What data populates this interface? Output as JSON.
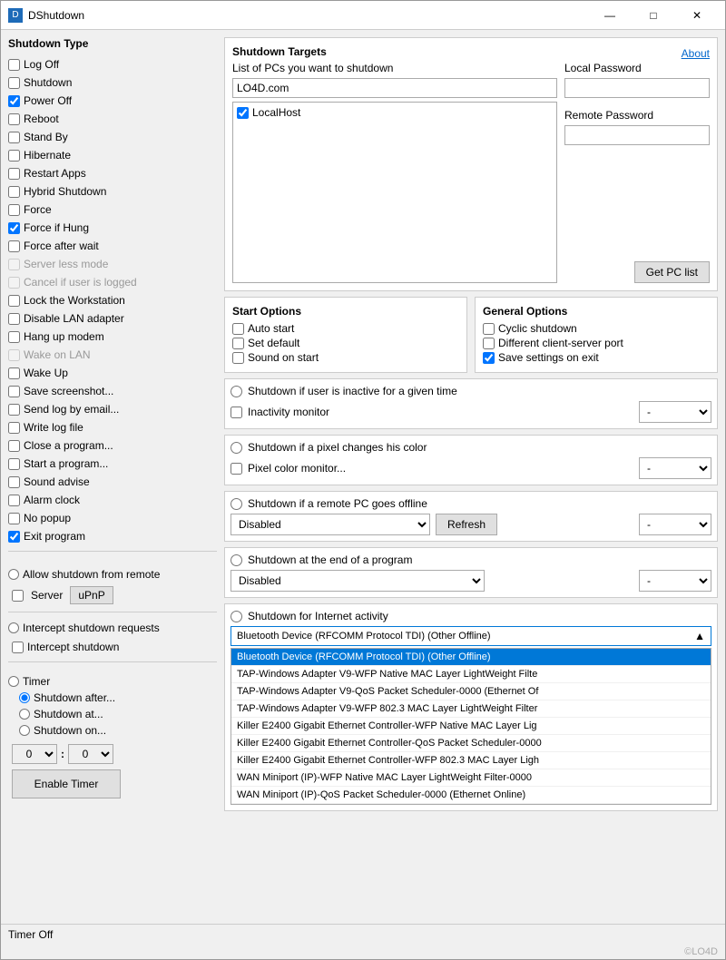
{
  "window": {
    "title": "DShutdown",
    "icon": "D"
  },
  "titlebar_buttons": {
    "minimize": "—",
    "maximize": "□",
    "close": "✕"
  },
  "left_panel": {
    "section_title": "Shutdown Type",
    "checkboxes": [
      {
        "id": "logoff",
        "label": "Log Off",
        "checked": false,
        "disabled": false
      },
      {
        "id": "shutdown",
        "label": "Shutdown",
        "checked": false,
        "disabled": false
      },
      {
        "id": "poweroff",
        "label": "Power Off",
        "checked": true,
        "disabled": false
      },
      {
        "id": "reboot",
        "label": "Reboot",
        "checked": false,
        "disabled": false
      },
      {
        "id": "standby",
        "label": "Stand By",
        "checked": false,
        "disabled": false
      },
      {
        "id": "hibernate",
        "label": "Hibernate",
        "checked": false,
        "disabled": false
      },
      {
        "id": "restartapps",
        "label": "Restart Apps",
        "checked": false,
        "disabled": false
      },
      {
        "id": "hybridshutdown",
        "label": "Hybrid Shutdown",
        "checked": false,
        "disabled": false
      },
      {
        "id": "force",
        "label": "Force",
        "checked": false,
        "disabled": false
      },
      {
        "id": "forcehung",
        "label": "Force if Hung",
        "checked": true,
        "disabled": false
      },
      {
        "id": "forceafter",
        "label": "Force after wait",
        "checked": false,
        "disabled": false
      },
      {
        "id": "serverless",
        "label": "Server less mode",
        "checked": false,
        "disabled": true
      },
      {
        "id": "canceluser",
        "label": "Cancel if user is logged",
        "checked": false,
        "disabled": true
      },
      {
        "id": "lockws",
        "label": "Lock the Workstation",
        "checked": false,
        "disabled": false
      },
      {
        "id": "disablelan",
        "label": "Disable LAN adapter",
        "checked": false,
        "disabled": false
      },
      {
        "id": "hangup",
        "label": "Hang up modem",
        "checked": false,
        "disabled": false
      },
      {
        "id": "wakeonlan",
        "label": "Wake on LAN",
        "checked": false,
        "disabled": true
      },
      {
        "id": "wakeup",
        "label": "Wake Up",
        "checked": false,
        "disabled": false
      },
      {
        "id": "screenshot",
        "label": "Save screenshot...",
        "checked": false,
        "disabled": false
      },
      {
        "id": "sendlog",
        "label": "Send log by email...",
        "checked": false,
        "disabled": false
      },
      {
        "id": "writelog",
        "label": "Write log file",
        "checked": false,
        "disabled": false
      },
      {
        "id": "closeprogram",
        "label": "Close a program...",
        "checked": false,
        "disabled": false
      },
      {
        "id": "startprogram",
        "label": "Start a program...",
        "checked": false,
        "disabled": false
      },
      {
        "id": "soundadvise",
        "label": "Sound advise",
        "checked": false,
        "disabled": false
      },
      {
        "id": "alarmclock",
        "label": "Alarm clock",
        "checked": false,
        "disabled": false
      },
      {
        "id": "nopopup",
        "label": "No popup",
        "checked": false,
        "disabled": false
      },
      {
        "id": "exitprogram",
        "label": "Exit program",
        "checked": true,
        "disabled": false
      }
    ],
    "remote_section": {
      "title": "Allow shutdown from remote",
      "server_label": "Server",
      "upnp_label": "uPnP"
    },
    "intercept_section": {
      "title": "Intercept shutdown requests",
      "checkbox_label": "Intercept shutdown"
    },
    "timer_section": {
      "title": "Timer",
      "radio_after": "Shutdown after...",
      "radio_at": "Shutdown at...",
      "radio_on": "Shutdown on...",
      "hours": "0",
      "minutes": "0",
      "enable_btn": "Enable Timer"
    },
    "status": "Timer Off"
  },
  "right_panel": {
    "targets_title": "Shutdown Targets",
    "about_label": "About",
    "pc_list_label": "List of PCs you want to shutdown",
    "pc_input_value": "LO4D.com",
    "pc_list_items": [
      {
        "label": "LocalHost",
        "checked": true
      }
    ],
    "local_password_label": "Local Password",
    "remote_password_label": "Remote Password",
    "get_pc_list_btn": "Get PC list",
    "start_options": {
      "title": "Start Options",
      "items": [
        {
          "id": "autostart",
          "label": "Auto start",
          "checked": false
        },
        {
          "id": "setdefault",
          "label": "Set default",
          "checked": false
        },
        {
          "id": "soundstart",
          "label": "Sound on start",
          "checked": false
        }
      ]
    },
    "general_options": {
      "title": "General Options",
      "items": [
        {
          "id": "cyclic",
          "label": "Cyclic shutdown",
          "checked": false
        },
        {
          "id": "diffclient",
          "label": "Different client-server port",
          "checked": false
        },
        {
          "id": "savesettings",
          "label": "Save settings on exit",
          "checked": true
        }
      ]
    },
    "inactive_shutdown": {
      "title": "Shutdown if user is inactive for a given time",
      "checkbox_label": "Inactivity monitor",
      "checkbox_checked": false,
      "dropdown_value": "-"
    },
    "pixel_shutdown": {
      "title": "Shutdown if a pixel changes his color",
      "checkbox_label": "Pixel color monitor...",
      "checkbox_checked": false,
      "dropdown_value": "-"
    },
    "remote_offline": {
      "title": "Shutdown if a remote PC goes offline",
      "dropdown_value": "Disabled",
      "refresh_btn": "Refresh",
      "dropdown2_value": "-"
    },
    "end_program": {
      "title": "Shutdown at the end of a program",
      "dropdown_value": "Disabled",
      "dropdown2_value": "-"
    },
    "internet_activity": {
      "title": "Shutdown for Internet activity",
      "dropdown_value": "Bluetooth Device (RFCOMM Protocol TDI) (Other Offline)",
      "network_items": [
        {
          "label": "Bluetooth Device (RFCOMM Protocol TDI) (Other Offline)",
          "selected": true
        },
        {
          "label": "TAP-Windows Adapter V9-WFP Native MAC Layer LightWeight Filte",
          "selected": false
        },
        {
          "label": "TAP-Windows Adapter V9-QoS Packet Scheduler-0000 (Ethernet Of",
          "selected": false
        },
        {
          "label": "TAP-Windows Adapter V9-WFP 802.3 MAC Layer LightWeight Filter",
          "selected": false
        },
        {
          "label": "Killer E2400 Gigabit Ethernet Controller-WFP Native MAC Layer Lig",
          "selected": false
        },
        {
          "label": "Killer E2400 Gigabit Ethernet Controller-QoS Packet Scheduler-0000",
          "selected": false
        },
        {
          "label": "Killer E2400 Gigabit Ethernet Controller-WFP 802.3 MAC Layer Ligh",
          "selected": false
        },
        {
          "label": "WAN Miniport (IP)-WFP Native MAC Layer LightWeight Filter-0000",
          "selected": false
        },
        {
          "label": "WAN Miniport (IP)-QoS Packet Scheduler-0000 (Ethernet Online)",
          "selected": false
        }
      ]
    }
  },
  "watermark": "©LO4D"
}
